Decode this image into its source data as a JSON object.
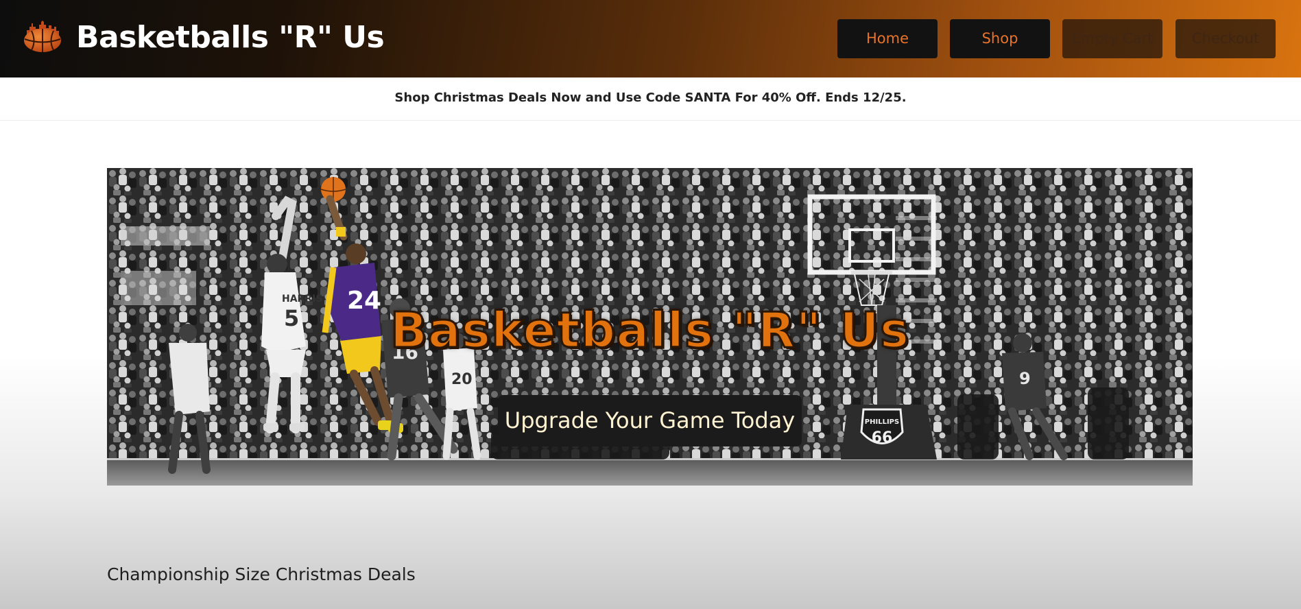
{
  "header": {
    "brand": "Basketballs \"R\" Us",
    "logo_icon": "basketball-skyline-logo-icon",
    "nav": [
      {
        "label": "Home"
      },
      {
        "label": "Shop"
      },
      {
        "label": "Empty Cart"
      },
      {
        "label": "Checkout"
      }
    ]
  },
  "promo": {
    "text": "Shop Christmas Deals Now and Use Code SANTA For 40% Off. Ends 12/25."
  },
  "hero": {
    "title": "Basketballs \"R\" Us",
    "cta_label": "Upgrade Your Game Today",
    "jersey_numbers": [
      "5",
      "24",
      "16",
      "20",
      "9",
      "66"
    ],
    "player_name": "HARRIS",
    "sign_brand": "PHILLIPS"
  },
  "section": {
    "title": "Championship Size Christmas Deals"
  },
  "colors": {
    "accent": "#e8732a",
    "header_dark": "#0d0d0d",
    "header_orange": "#d8730f",
    "hero_title": "#e2720e",
    "cta_text": "#fff3d2",
    "lakers_purple": "#4a2a86",
    "lakers_gold": "#f2c81c"
  }
}
